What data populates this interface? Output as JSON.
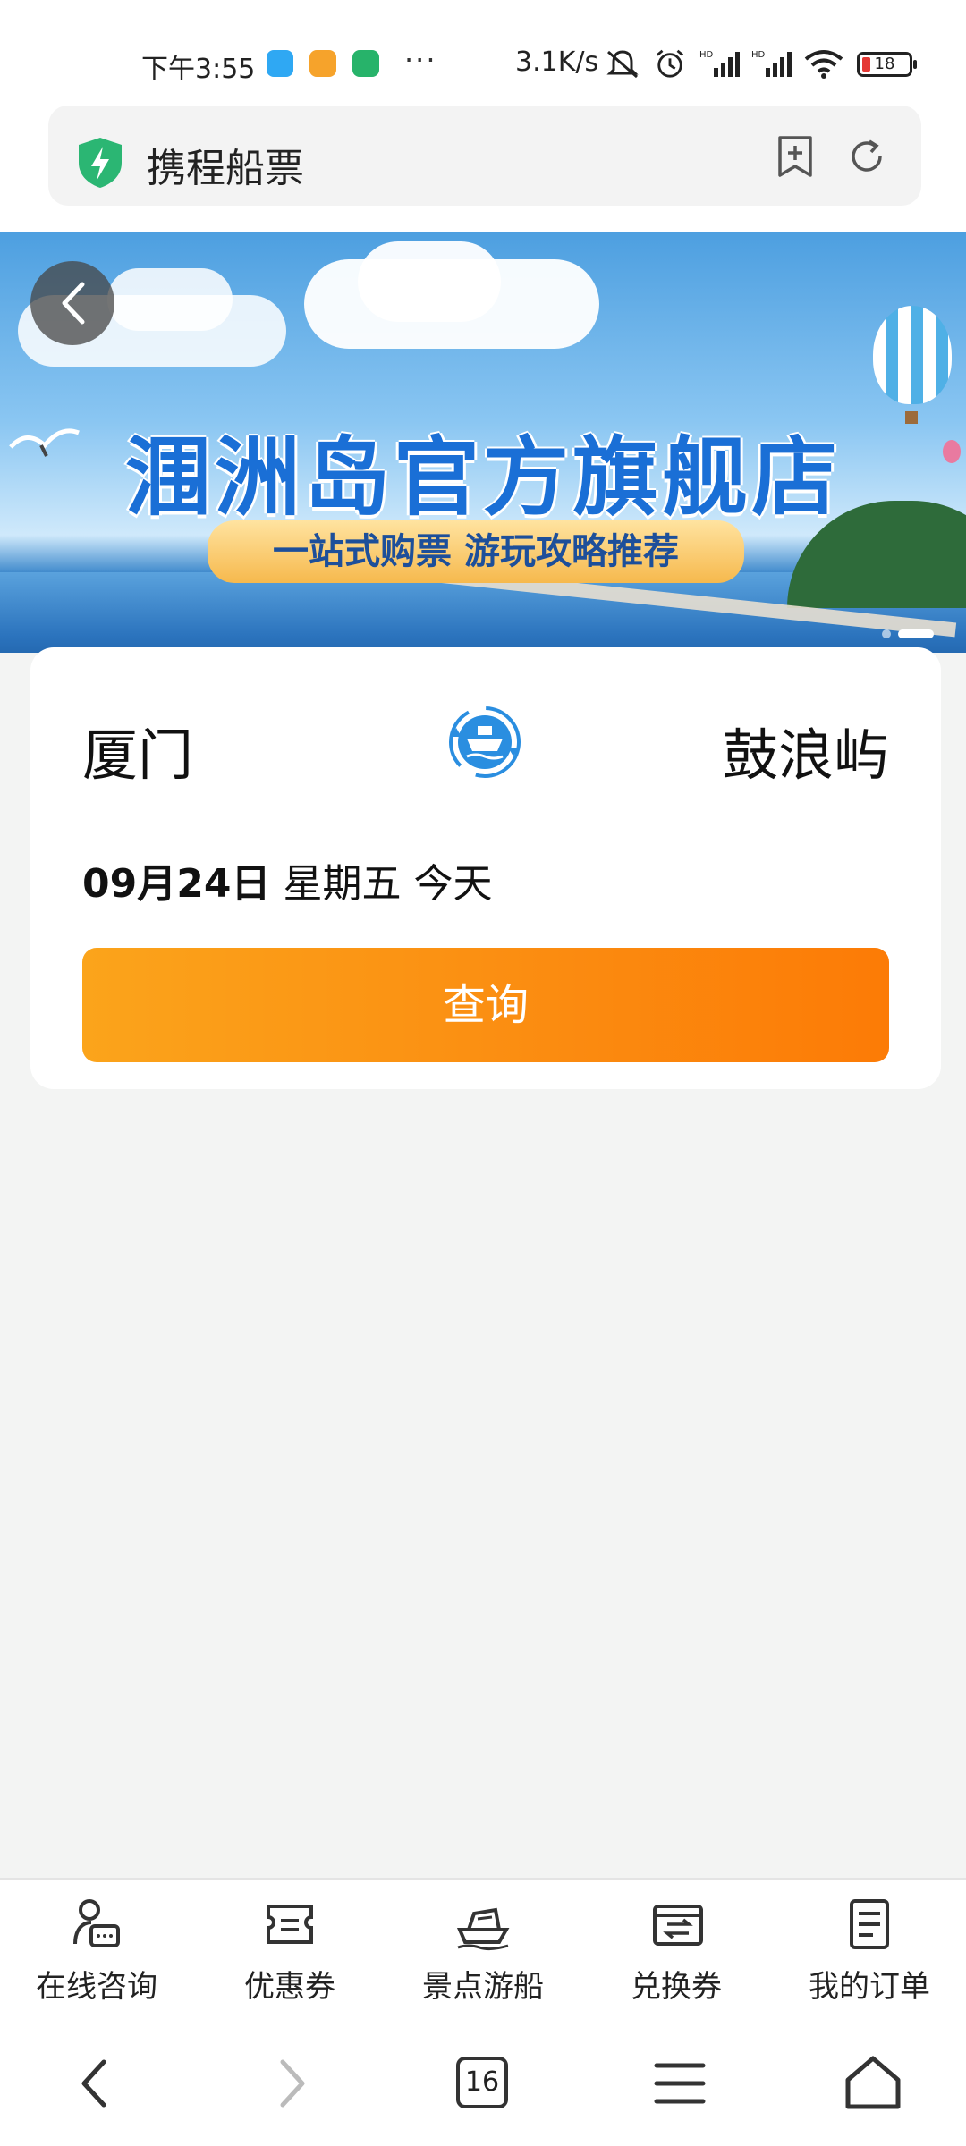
{
  "status_bar": {
    "time": "下午3:55",
    "more": "···",
    "net_speed": "3.1K/s",
    "battery": "18"
  },
  "address_bar": {
    "title": "携程船票"
  },
  "banner": {
    "title": "涠洲岛官方旗舰店",
    "subtitle": "一站式购票 游玩攻略推荐"
  },
  "search_card": {
    "from_city": "厦门",
    "to_city": "鼓浪屿",
    "date_md": "09月24日",
    "weekday": "星期五",
    "relative_day": "今天",
    "query_button": "查询"
  },
  "bottom_tabs": [
    {
      "label": "在线咨询",
      "icon": "consult-icon"
    },
    {
      "label": "优惠券",
      "icon": "coupon-icon"
    },
    {
      "label": "景点游船",
      "icon": "ship-icon"
    },
    {
      "label": "兑换券",
      "icon": "exchange-icon"
    },
    {
      "label": "我的订单",
      "icon": "order-icon"
    }
  ],
  "system_nav": {
    "tabs_count": "16"
  },
  "colors": {
    "accent_orange": "#fc7b06",
    "brand_blue": "#1a6fd6",
    "shield_green": "#2bb673"
  }
}
